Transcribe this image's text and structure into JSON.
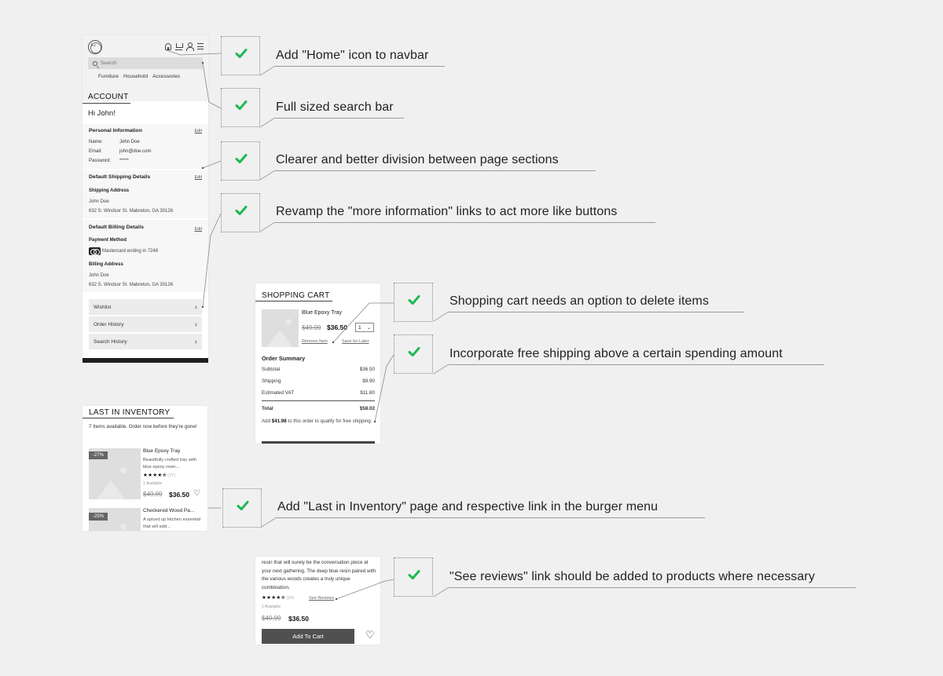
{
  "account_page": {
    "logo_text": "h.c",
    "nav_icons": [
      "home-icon",
      "cart-icon",
      "user-icon",
      "menu-icon"
    ],
    "search": {
      "placeholder": "Search",
      "value": ""
    },
    "categories": [
      "Furniture",
      "Household",
      "Accessories"
    ],
    "title": "ACCOUNT",
    "greeting": "Hi John!",
    "personal": {
      "heading": "Personal Information",
      "edit_label": "Edit",
      "fields": [
        {
          "label": "Name:",
          "value": "John Doe"
        },
        {
          "label": "Email:",
          "value": "john@doe.com"
        },
        {
          "label": "Password:",
          "value": "*****"
        }
      ]
    },
    "shipping": {
      "heading": "Default Shipping Details",
      "edit_label": "Edit",
      "address_label": "Shipping Address",
      "name": "John Doe",
      "address": "632 S. Windsor St. Mabreton, GA 30126"
    },
    "billing": {
      "heading": "Default Billing Details",
      "edit_label": "Edit",
      "payment_label": "Payment Method",
      "card": "Mastercard ending in 7248",
      "address_label": "Billing Address",
      "name": "John Doe",
      "address": "632 S. Windsor St. Mabreton, GA 30126"
    },
    "links": [
      {
        "label": "Wishlist"
      },
      {
        "label": "Order History"
      },
      {
        "label": "Search History"
      }
    ],
    "chevron": "›"
  },
  "cart_page": {
    "title": "SHOPPING CART",
    "item": {
      "name": "Blue Epoxy Tray",
      "old_price": "$49.99",
      "price": "$36.50",
      "qty": "1",
      "remove_label": "Remove Item",
      "save_label": "Save for Later"
    },
    "summary": {
      "heading": "Order Summary",
      "rows": [
        {
          "label": "Subtotal",
          "value": "$36.50"
        },
        {
          "label": "Shipping",
          "value": "$9.90"
        },
        {
          "label": "Estimated VAT",
          "value": "$11.80"
        }
      ],
      "total_label": "Total",
      "total_value": "$58.02",
      "note_prefix": "Add ",
      "note_amount": "$41.98",
      "note_suffix": " to this order to qualify for free shipping."
    }
  },
  "inventory_page": {
    "title": "LAST IN INVENTORY",
    "intro": "7 Items available. Order now before they're gone!",
    "products": [
      {
        "badge": "-27%",
        "name": "Blue Epoxy Tray",
        "desc": "Beautifully crafted tray with blue epoxy resin...",
        "stars": "★★★★✯",
        "rating_count": "(27)",
        "availability": "1 Available",
        "old_price": "$49.99",
        "price": "$36.50"
      },
      {
        "badge": "-25%",
        "name": "Checkered Wood Pa...",
        "desc": "A spiced up kitchen essential that will add..."
      }
    ]
  },
  "product_page": {
    "description": "resin that will surely be the conversation piece at your next gathering. The deep blue resin paired with the various woods creates a truly unique combination.",
    "stars": "★★★★✯",
    "rating_count": "(24)",
    "see_reviews": "See Reviews",
    "availability": "1 Available",
    "old_price": "$49.99",
    "price": "$36.50",
    "add_to_cart": "Add To Cart"
  },
  "callouts": [
    {
      "text": "Add \"Home\" icon to navbar",
      "status": "done"
    },
    {
      "text": "Full sized search bar",
      "status": "done"
    },
    {
      "text": "Clearer and better division between page sections",
      "status": "done"
    },
    {
      "text": "Revamp the \"more information\" links to act more like buttons",
      "status": "done"
    },
    {
      "text": "Shopping cart needs an option to delete items",
      "status": "done"
    },
    {
      "text": "Incorporate free shipping above a certain spending amount",
      "status": "done"
    },
    {
      "text": "Add \"Last in Inventory\" page and respective link in the burger menu",
      "status": "done"
    },
    {
      "text": "\"See reviews\" link should be added to products where necessary",
      "status": "done"
    }
  ],
  "colors": {
    "check": "#1db954",
    "background": "#f0f0f0",
    "dark_button": "#505050"
  }
}
